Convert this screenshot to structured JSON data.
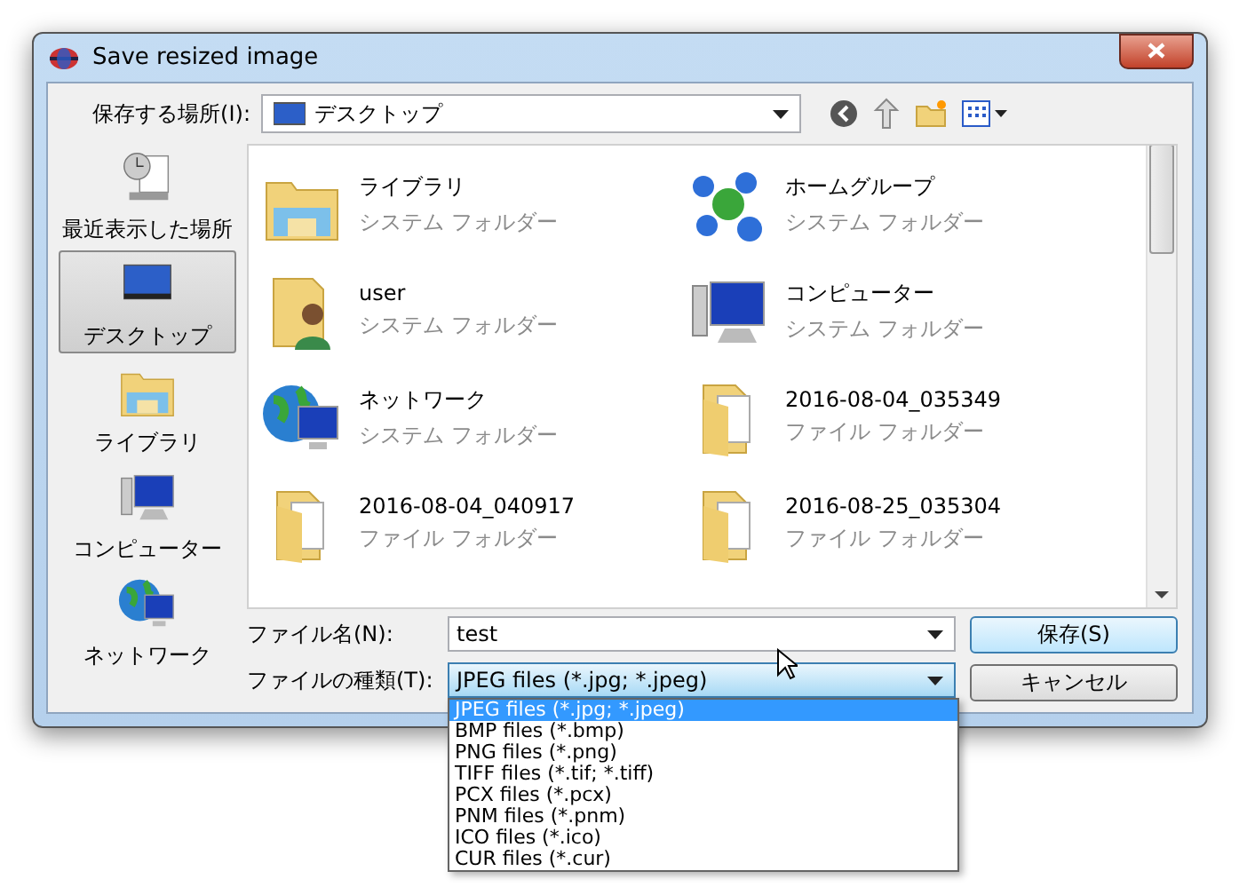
{
  "window": {
    "title": "Save resized image"
  },
  "location": {
    "label": "保存する場所(I):",
    "value": "デスクトップ"
  },
  "sidebar": {
    "items": [
      {
        "label": "最近表示した場所",
        "kind": "recent",
        "selected": false
      },
      {
        "label": "デスクトップ",
        "kind": "desktop",
        "selected": true
      },
      {
        "label": "ライブラリ",
        "kind": "library",
        "selected": false
      },
      {
        "label": "コンピューター",
        "kind": "computer",
        "selected": false
      },
      {
        "label": "ネットワーク",
        "kind": "network",
        "selected": false
      }
    ]
  },
  "files": [
    {
      "name": "ライブラリ",
      "type": "システム フォルダー",
      "kind": "library"
    },
    {
      "name": "ホームグループ",
      "type": "システム フォルダー",
      "kind": "homegroup"
    },
    {
      "name": "user",
      "type": "システム フォルダー",
      "kind": "user"
    },
    {
      "name": "コンピューター",
      "type": "システム フォルダー",
      "kind": "computer"
    },
    {
      "name": "ネットワーク",
      "type": "システム フォルダー",
      "kind": "network"
    },
    {
      "name": "2016-08-04_035349",
      "type": "ファイル フォルダー",
      "kind": "folder"
    },
    {
      "name": "2016-08-04_040917",
      "type": "ファイル フォルダー",
      "kind": "folder"
    },
    {
      "name": "2016-08-25_035304",
      "type": "ファイル フォルダー",
      "kind": "folder"
    }
  ],
  "file_name": {
    "label": "ファイル名(N):",
    "value": "test"
  },
  "file_type": {
    "label": "ファイルの種類(T):",
    "value": "JPEG files (*.jpg; *.jpeg)",
    "expanded": true,
    "options": [
      {
        "label": "JPEG files (*.jpg; *.jpeg)",
        "selected": true
      },
      {
        "label": "BMP files (*.bmp)",
        "selected": false
      },
      {
        "label": "PNG files (*.png)",
        "selected": false
      },
      {
        "label": "TIFF files (*.tif; *.tiff)",
        "selected": false
      },
      {
        "label": "PCX files (*.pcx)",
        "selected": false
      },
      {
        "label": "PNM files (*.pnm)",
        "selected": false
      },
      {
        "label": "ICO files (*.ico)",
        "selected": false
      },
      {
        "label": "CUR files (*.cur)",
        "selected": false
      }
    ]
  },
  "buttons": [
    {
      "label": "保存(S)",
      "kind": "primary"
    },
    {
      "label": "キャンセル",
      "kind": "normal"
    }
  ]
}
